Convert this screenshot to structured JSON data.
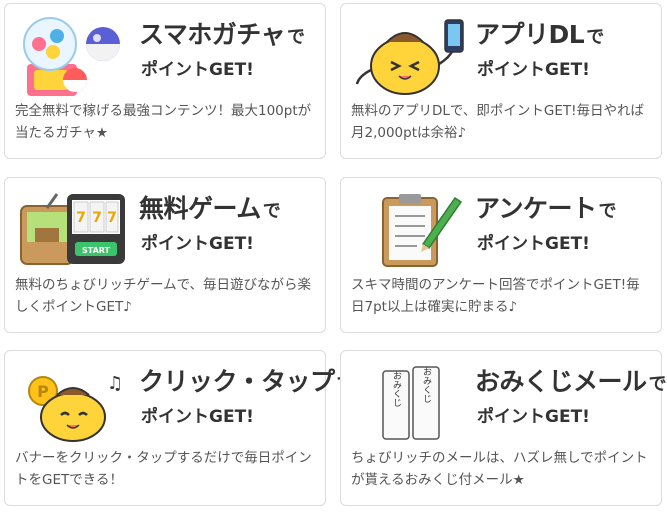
{
  "cards": [
    {
      "title": "スマホガチャ",
      "suffix": "で",
      "subtitle": "ポイントGET!",
      "description": "完全無料で稼げる最強コンテンツ！最大100ptが当たるガチャ★",
      "icon": "gacha-capsule-icon"
    },
    {
      "title": "アプリDL",
      "suffix": "で",
      "subtitle": "ポイントGET!",
      "description": "無料のアプリDLで、即ポイントGET!毎日やれば月2,000ptは余裕♪",
      "icon": "mascot-smartphone-icon"
    },
    {
      "title": "無料ゲーム",
      "suffix": "で",
      "subtitle": "ポイントGET!",
      "description": "無料のちょびリッチゲームで、毎日遊びながら楽しくポイントGET♪",
      "icon": "slot-machine-icon"
    },
    {
      "title": "アンケート",
      "suffix": "で",
      "subtitle": "ポイントGET!",
      "description": "スキマ時間のアンケート回答でポイントGET!毎日7pt以上は確実に貯まる♪",
      "icon": "clipboard-pencil-icon"
    },
    {
      "title": "クリック・タップ",
      "suffix": "で",
      "subtitle": "ポイントGET!",
      "description": "バナーをクリック・タップするだけで毎日ポイントをGETできる！",
      "icon": "mascot-coin-icon"
    },
    {
      "title": "おみくじメール",
      "suffix": "で",
      "subtitle": "ポイントGET!",
      "description": "ちょびリッチのメールは、ハズレ無しでポイントが貰えるおみくじ付メール★",
      "icon": "omikuji-icon"
    }
  ],
  "illustration_text": {
    "start": "START",
    "coin_letter": "P",
    "omikuji_1": "おみくじ",
    "omikuji_2": "おみくじ"
  },
  "colors": {
    "border": "#dcdcdc",
    "title": "#333333",
    "text": "#555555",
    "mascot": "#ffd43a"
  }
}
